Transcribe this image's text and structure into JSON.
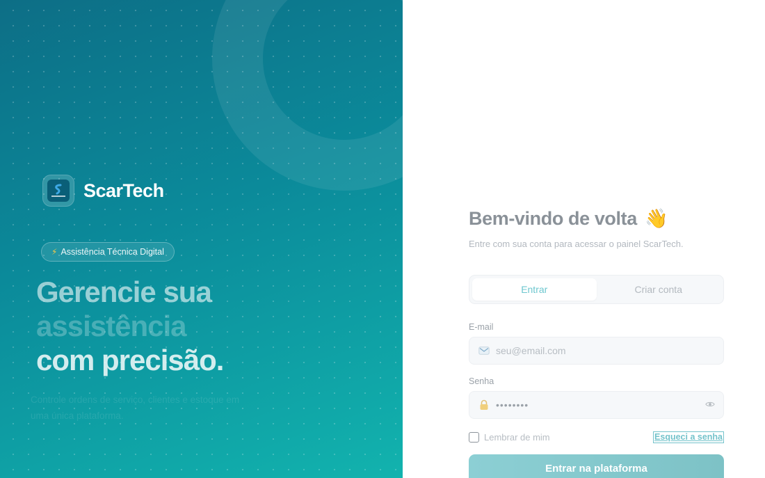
{
  "hero": {
    "brand_name": "ScarTech",
    "badge": "Assistência Técnica Digital",
    "headline": [
      "Gerencie sua",
      "assistência",
      "com precisão."
    ],
    "description": "Controle ordens de serviço, clientes e estoque em uma única plataforma."
  },
  "login": {
    "title": "Bem-vindo de volta",
    "wave": "👋",
    "subtitle": "Entre com sua conta para acessar o painel ScarTech.",
    "tabs": [
      {
        "label": "Entrar",
        "active": true
      },
      {
        "label": "Criar conta",
        "active": false
      }
    ],
    "email_label": "E-mail",
    "email_placeholder": "seu@email.com",
    "password_label": "Senha",
    "password_value": "password",
    "remember_label": "Lembrar de mim",
    "forgot_label": "Esqueci a senha",
    "submit_label": "Entrar na plataforma"
  },
  "colors": {
    "accent": "#12b3ae",
    "accent_dark": "#0d6e86",
    "button": "#7dc2c6"
  }
}
